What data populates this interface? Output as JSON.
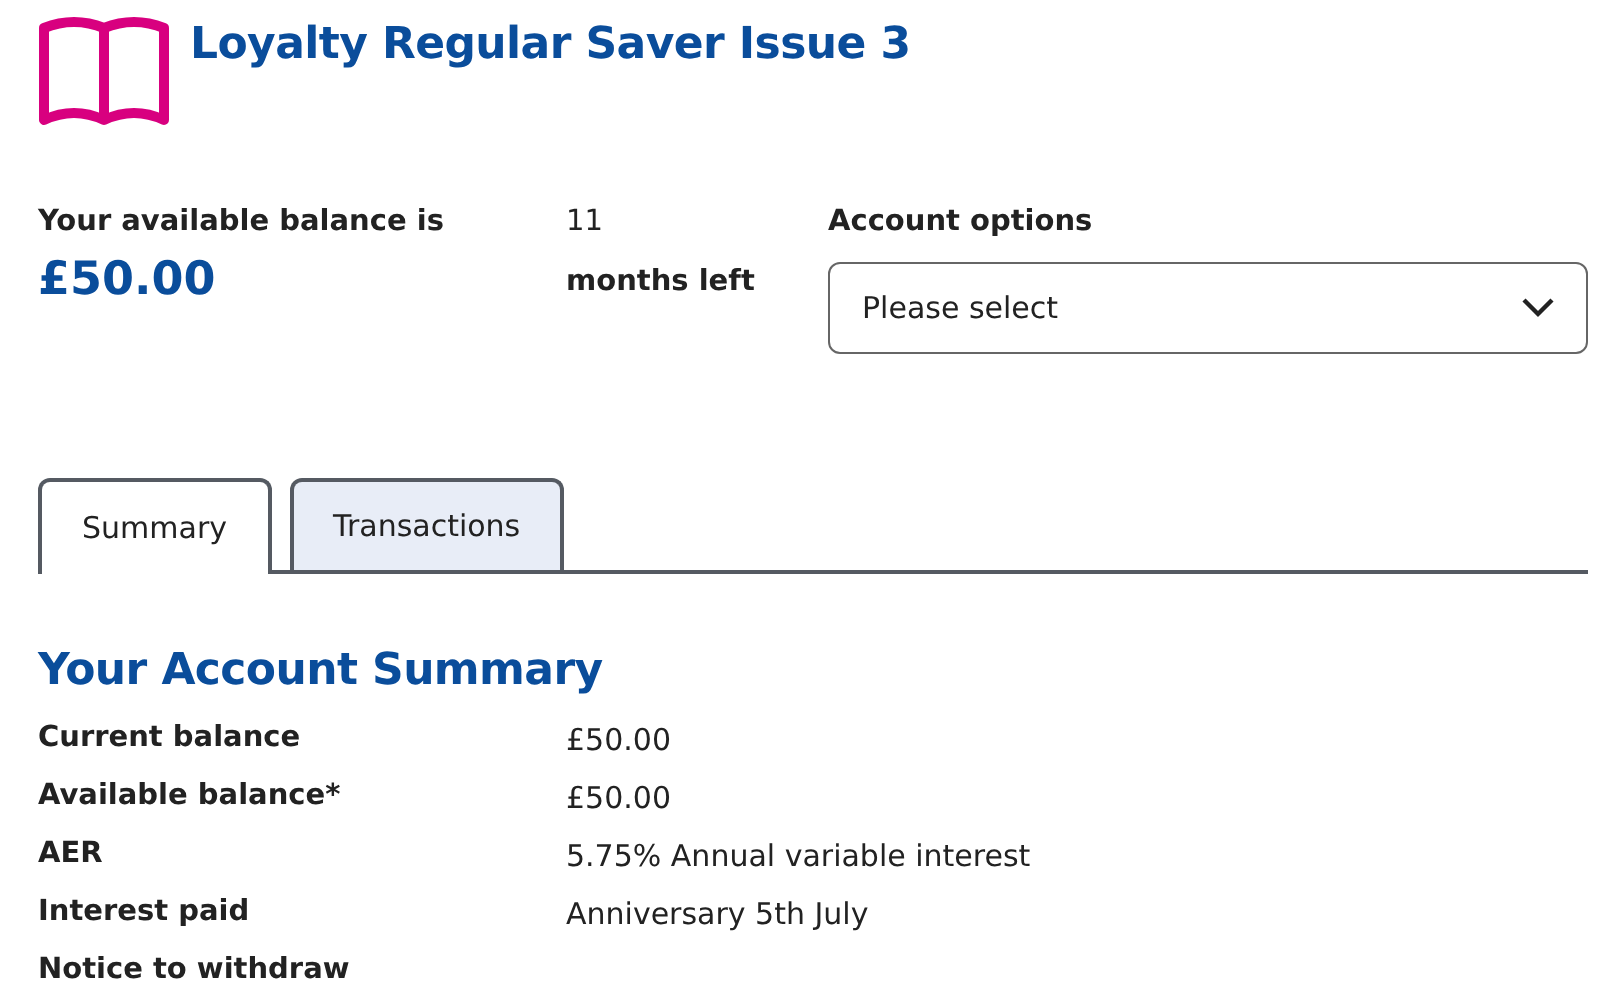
{
  "header": {
    "title": "Loyalty Regular Saver Issue 3"
  },
  "balance": {
    "label": "Your available balance is",
    "amount": "£50.00"
  },
  "term": {
    "count": "11",
    "label": "months left"
  },
  "account_options": {
    "label": "Account options",
    "value": "Please select"
  },
  "tabs": [
    {
      "label": "Summary",
      "selected": true
    },
    {
      "label": "Transactions",
      "selected": false
    }
  ],
  "summary": {
    "heading": "Your Account Summary",
    "rows": [
      {
        "label": "Current balance",
        "value": "£50.00"
      },
      {
        "label": "Available balance*",
        "value": "£50.00"
      },
      {
        "label": "AER",
        "value": "5.75% Annual variable interest"
      },
      {
        "label": "Interest paid",
        "value": "Anniversary 5th July"
      },
      {
        "label": "Notice to withdraw"
      }
    ]
  }
}
